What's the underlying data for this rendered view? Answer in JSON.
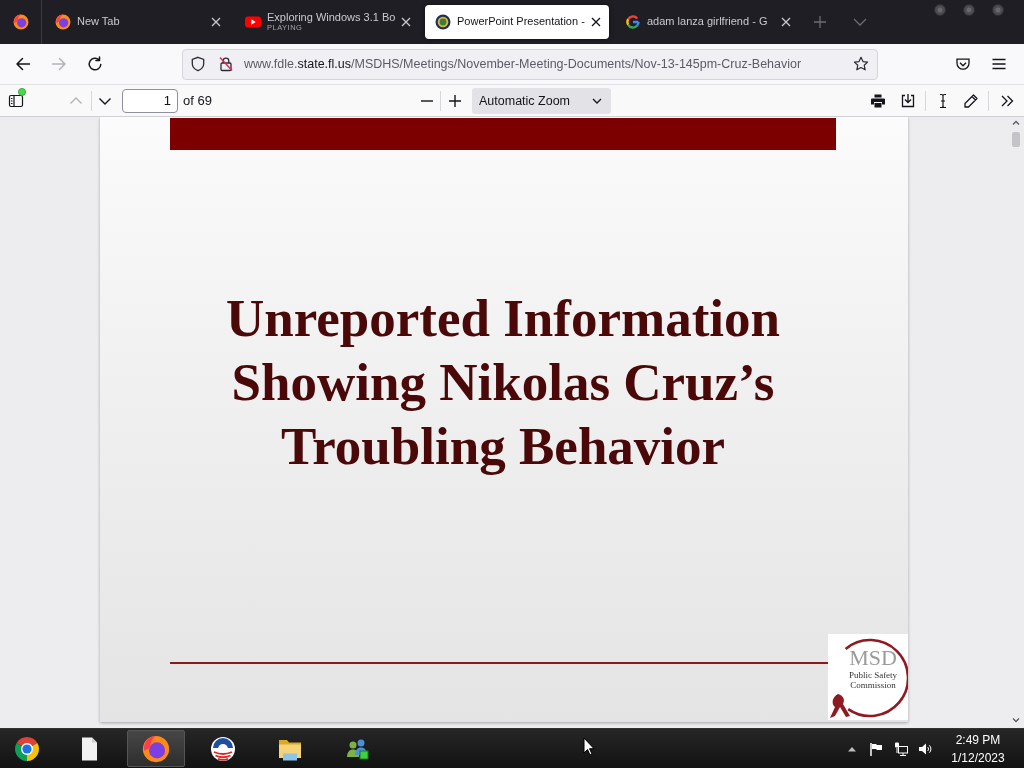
{
  "tab_bar": {
    "tabs": [
      {
        "kind": "firefox",
        "title": "New Tab",
        "selected": false
      },
      {
        "kind": "youtube",
        "title": "Exploring Windows 3.1 Bo",
        "subtitle": "PLAYING",
        "selected": false
      },
      {
        "kind": "seal",
        "title": "PowerPoint Presentation -",
        "selected": true
      },
      {
        "kind": "google",
        "title": "adam lanza girlfriend - G",
        "selected": false
      }
    ]
  },
  "nav_bar": {
    "buttons": [
      {
        "kind": "back",
        "disabled": false
      },
      {
        "kind": "forward",
        "disabled": true
      },
      {
        "kind": "reload",
        "disabled": false
      }
    ],
    "url": {
      "host_prefix": "www.fdle.",
      "domain": "state.fl.us",
      "path": "/MSDHS/Meetings/November-Meeting-Documents/Nov-13-145pm-Cruz-Behavior"
    }
  },
  "pdf_toolbar": {
    "sidebar_notification": true,
    "page_buttons": [
      {
        "kind": "previous",
        "disabled": true
      },
      {
        "kind": "next",
        "disabled": false
      }
    ],
    "page_number": "1",
    "page_count": "of 69",
    "zoom": "Automatic Zoom"
  },
  "slide": {
    "title_lines": [
      "Unreported Information",
      "Showing Nikolas Cruz’s",
      "Troubling Behavior"
    ],
    "logo": {
      "text": "MSD",
      "subtitle": "Public Safety Commission"
    }
  },
  "taskbar": {
    "apps": [
      {
        "kind": "chrome",
        "active": false
      },
      {
        "kind": "document",
        "active": false
      },
      {
        "kind": "firefox",
        "active": true
      },
      {
        "kind": "campaign",
        "active": false
      },
      {
        "kind": "folder",
        "active": false
      },
      {
        "kind": "people",
        "active": false
      }
    ],
    "clock": {
      "time": "2:49 PM",
      "date": "1/12/2023"
    }
  }
}
